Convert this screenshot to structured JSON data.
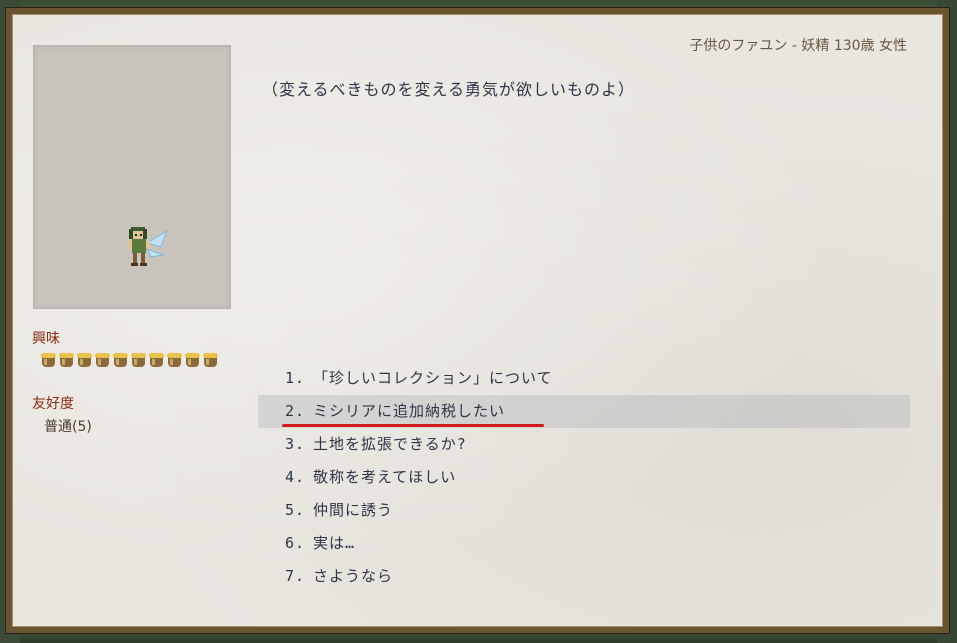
{
  "header": {
    "title": "子供のファユン - 妖精 130歳 女性"
  },
  "speech": "（変えるべきものを変える勇気が欲しいものよ）",
  "stats": {
    "interest_label": "興味",
    "interest_level": 10,
    "friendship_label": "友好度",
    "friendship_value": "普通(5)"
  },
  "choices": [
    {
      "num": "1.",
      "text": "「珍しいコレクション」について"
    },
    {
      "num": "2.",
      "text": "ミシリアに追加納税したい"
    },
    {
      "num": "3.",
      "text": "土地を拡張できるか?"
    },
    {
      "num": "4.",
      "text": "敬称を考えてほしい"
    },
    {
      "num": "5.",
      "text": "仲間に誘う"
    },
    {
      "num": "6.",
      "text": "実は…"
    },
    {
      "num": "7.",
      "text": "さようなら"
    }
  ],
  "selected_choice": 2,
  "colors": {
    "accent_red": "#d41a1a",
    "label_red": "#8a2a12",
    "text_navy": "#2d3548"
  }
}
